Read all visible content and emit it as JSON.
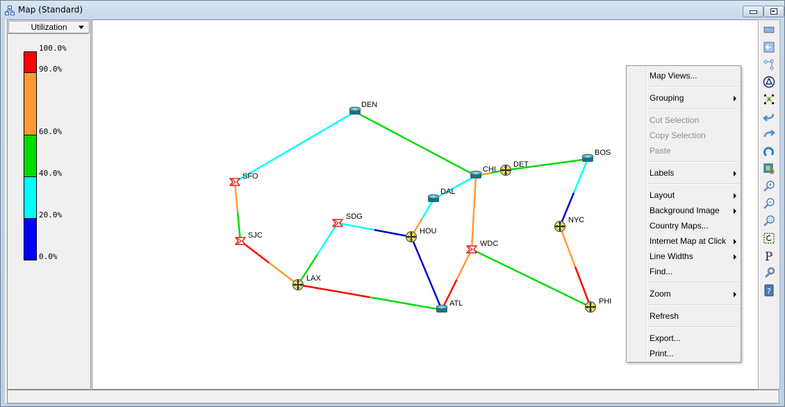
{
  "window": {
    "title": "Map (Standard)",
    "icon": "network-map-icon",
    "buttons": [
      "minimize",
      "maximize"
    ]
  },
  "legend": {
    "metric_selector": {
      "value": "Utilization"
    },
    "scale": [
      {
        "from": 90,
        "to": 100,
        "color": "#ff0000"
      },
      {
        "from": 60,
        "to": 90,
        "color": "#ff9933"
      },
      {
        "from": 40,
        "to": 60,
        "color": "#00dd00"
      },
      {
        "from": 20,
        "to": 40,
        "color": "#00ffff"
      },
      {
        "from": 0,
        "to": 20,
        "color": "#0000ff"
      }
    ],
    "labels": [
      "100.0%",
      "90.0%",
      "60.0%",
      "40.0%",
      "20.0%",
      "0.0%"
    ]
  },
  "map": {
    "nodes": [
      {
        "id": "DEN",
        "label": "DEN",
        "type": "router"
      },
      {
        "id": "SFO",
        "label": "SFO",
        "type": "firewall"
      },
      {
        "id": "SJC",
        "label": "SJC",
        "type": "firewall"
      },
      {
        "id": "LAX",
        "label": "LAX",
        "type": "switch"
      },
      {
        "id": "SDG",
        "label": "SDG",
        "type": "firewall"
      },
      {
        "id": "HOU",
        "label": "HOU",
        "type": "switch"
      },
      {
        "id": "DAL",
        "label": "DAL",
        "type": "router"
      },
      {
        "id": "ATL",
        "label": "ATL",
        "type": "router"
      },
      {
        "id": "CHI",
        "label": "CHI",
        "type": "router"
      },
      {
        "id": "DET",
        "label": "DET",
        "type": "switch"
      },
      {
        "id": "WDC",
        "label": "WDC",
        "type": "firewall"
      },
      {
        "id": "BOS",
        "label": "BOS",
        "type": "router"
      },
      {
        "id": "NYC",
        "label": "NYC",
        "type": "switch"
      },
      {
        "id": "PHI",
        "label": "PHI",
        "type": "switch"
      }
    ],
    "links": [
      {
        "a": "SFO",
        "b": "DEN",
        "colors": [
          "#00ffff",
          "#00ffff"
        ]
      },
      {
        "a": "DEN",
        "b": "CHI",
        "colors": [
          "#00dd00",
          "#00dd00"
        ]
      },
      {
        "a": "SFO",
        "b": "SJC",
        "colors": [
          "#ff9933",
          "#00dd00"
        ]
      },
      {
        "a": "SJC",
        "b": "LAX",
        "colors": [
          "#ff0000",
          "#ff9933"
        ]
      },
      {
        "a": "LAX",
        "b": "SDG",
        "colors": [
          "#00dd00",
          "#00ffff"
        ]
      },
      {
        "a": "LAX",
        "b": "ATL",
        "colors": [
          "#ff0000",
          "#00dd00"
        ]
      },
      {
        "a": "SDG",
        "b": "HOU",
        "colors": [
          "#00ffff",
          "#0000cc"
        ]
      },
      {
        "a": "HOU",
        "b": "DAL",
        "colors": [
          "#ff9933",
          "#00ffff"
        ]
      },
      {
        "a": "HOU",
        "b": "ATL",
        "colors": [
          "#0000cc",
          "#0000cc"
        ]
      },
      {
        "a": "DAL",
        "b": "CHI",
        "colors": [
          "#00ffff",
          "#00ffff"
        ]
      },
      {
        "a": "CHI",
        "b": "DET",
        "colors": [
          "#ff9933",
          "#00dd00"
        ]
      },
      {
        "a": "CHI",
        "b": "WDC",
        "colors": [
          "#ff9933",
          "#ff9933"
        ]
      },
      {
        "a": "ATL",
        "b": "WDC",
        "colors": [
          "#ff0000",
          "#ff9933"
        ]
      },
      {
        "a": "DET",
        "b": "BOS",
        "colors": [
          "#00dd00",
          "#00dd00"
        ]
      },
      {
        "a": "WDC",
        "b": "PHI",
        "colors": [
          "#00dd00",
          "#00dd00"
        ]
      },
      {
        "a": "BOS",
        "b": "NYC",
        "colors": [
          "#00ffff",
          "#0000cc"
        ]
      },
      {
        "a": "NYC",
        "b": "PHI",
        "colors": [
          "#ff9933",
          "#ff0000"
        ]
      }
    ]
  },
  "context_menu": {
    "items": [
      {
        "label": "Map Views...",
        "enabled": true,
        "submenu": false
      },
      {
        "separator": true
      },
      {
        "label": "Grouping",
        "enabled": true,
        "submenu": true
      },
      {
        "separator": true
      },
      {
        "label": "Cut Selection",
        "enabled": false,
        "submenu": false
      },
      {
        "label": "Copy Selection",
        "enabled": false,
        "submenu": false
      },
      {
        "label": "Paste",
        "enabled": false,
        "submenu": false
      },
      {
        "separator": true
      },
      {
        "label": "Labels",
        "enabled": true,
        "submenu": true
      },
      {
        "separator": true
      },
      {
        "label": "Layout",
        "enabled": true,
        "submenu": true
      },
      {
        "label": "Background Image",
        "enabled": true,
        "submenu": true
      },
      {
        "label": "Country Maps...",
        "enabled": true,
        "submenu": false
      },
      {
        "label": "Internet Map at Click",
        "enabled": true,
        "submenu": true
      },
      {
        "label": "Line Widths",
        "enabled": true,
        "submenu": true
      },
      {
        "label": "Find...",
        "enabled": true,
        "submenu": false
      },
      {
        "separator": true
      },
      {
        "label": "Zoom",
        "enabled": true,
        "submenu": true
      },
      {
        "separator": true
      },
      {
        "label": "Refresh",
        "enabled": true,
        "submenu": false
      },
      {
        "separator": true
      },
      {
        "label": "Export...",
        "enabled": true,
        "submenu": false
      },
      {
        "label": "Print...",
        "enabled": true,
        "submenu": false
      }
    ]
  },
  "toolbar": {
    "buttons": [
      "select-area-icon",
      "back-to-parent-icon",
      "hierarchy-icon",
      "layout-triangle-icon",
      "arrange-nodes-icon",
      "undo-icon",
      "redo-icon",
      "refresh-icon",
      "background-image-icon",
      "zoom-in-icon",
      "zoom-out-icon",
      "zoom-fit-icon",
      "rotate-selection-icon",
      "properties-icon",
      "settings-wrench-icon",
      "help-icon"
    ]
  }
}
